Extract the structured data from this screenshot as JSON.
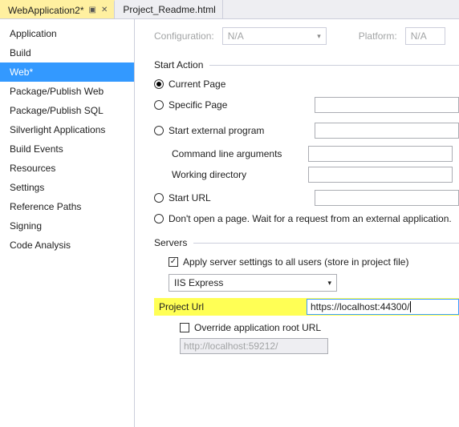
{
  "tabs": {
    "active": "WebApplication2*",
    "inactive": "Project_Readme.html"
  },
  "sidebar": [
    "Application",
    "Build",
    "Web*",
    "Package/Publish Web",
    "Package/Publish SQL",
    "Silverlight Applications",
    "Build Events",
    "Resources",
    "Settings",
    "Reference Paths",
    "Signing",
    "Code Analysis"
  ],
  "sidebar_selected_index": 2,
  "config": {
    "config_label": "Configuration:",
    "config_value": "N/A",
    "platform_label": "Platform:",
    "platform_value": "N/A"
  },
  "start_action": {
    "heading": "Start Action",
    "current_page": "Current Page",
    "specific_page": "Specific Page",
    "start_external": "Start external program",
    "cli_args": "Command line arguments",
    "working_dir": "Working directory",
    "start_url": "Start URL",
    "dont_start": "Don't open a page.  Wait for a request from an external application.",
    "selected": "current_page"
  },
  "servers": {
    "heading": "Servers",
    "apply_all": "Apply server settings to all users (store in project file)",
    "apply_all_checked": true,
    "server_select": "IIS Express",
    "project_url_label": "Project Url",
    "project_url_value": "https://localhost:44300/",
    "override_label": "Override application root URL",
    "override_checked": false,
    "override_value": "http://localhost:59212/"
  }
}
